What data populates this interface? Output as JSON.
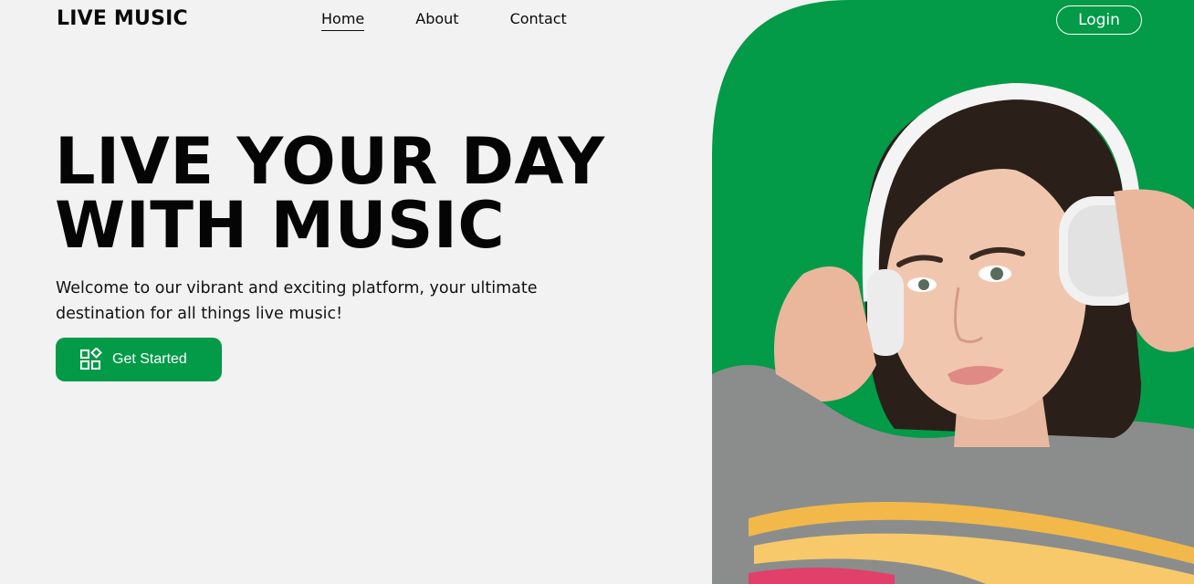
{
  "header": {
    "logo": "LIVE MUSIC",
    "nav": [
      {
        "label": "Home",
        "active": true
      },
      {
        "label": "About",
        "active": false
      },
      {
        "label": "Contact",
        "active": false
      }
    ],
    "login_label": "Login"
  },
  "hero": {
    "headline_line1": "LIVE YOUR DAY",
    "headline_line2": "WITH MUSIC",
    "intro": "Welcome to our vibrant and exciting platform, your ultimate destination for all things live music!",
    "cta_label": "Get Started",
    "cta_icon": "apps-grid-icon"
  },
  "visual": {
    "description_icon": "woman-with-headphones-image"
  },
  "colors": {
    "accent": "#039a48",
    "background": "#f2f2f2",
    "text": "#0a0a0a"
  }
}
